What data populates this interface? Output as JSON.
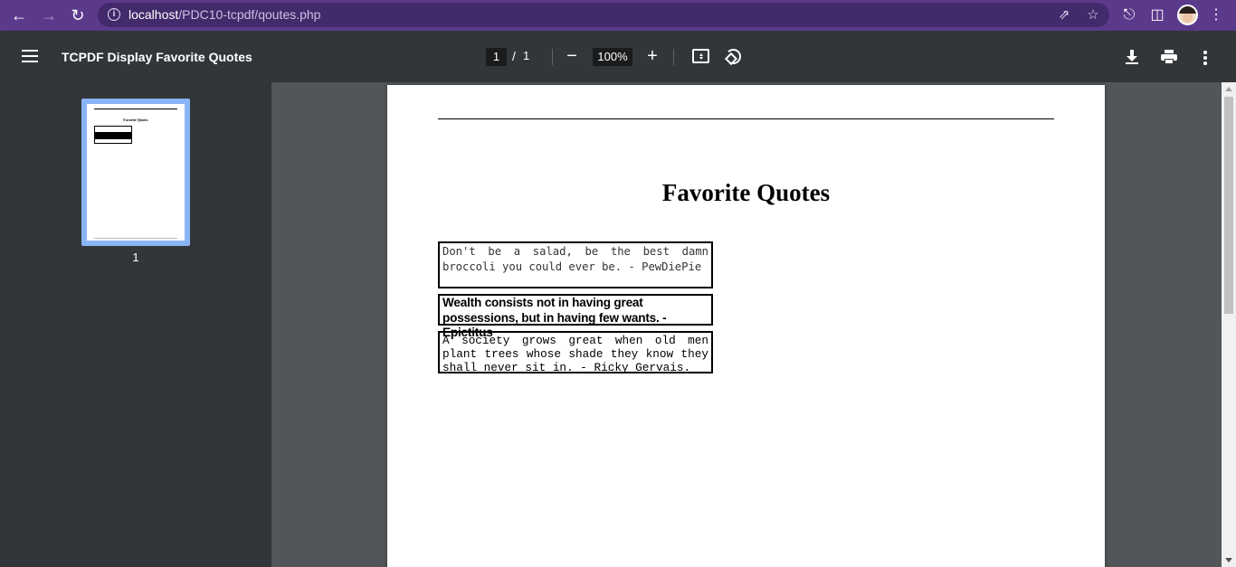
{
  "browser": {
    "url_host": "localhost",
    "url_path": "/PDC10-tcpdf/qoutes.php",
    "icons": [
      "back-icon",
      "forward-icon",
      "reload-icon",
      "info-icon",
      "share-icon",
      "bookmark-star-icon",
      "extensions-icon",
      "side-panel-icon",
      "profile-avatar",
      "chrome-menu-icon"
    ],
    "theme_color": "#5b3a8c"
  },
  "pdf_toolbar": {
    "title": "TCPDF Display Favorite Quotes",
    "current_page": "1",
    "page_separator": "/",
    "total_pages": "1",
    "zoom": "100%"
  },
  "sidebar": {
    "thumbnail_label": "1",
    "thumbnail_title": "Favorite Quotes"
  },
  "document": {
    "title": "Favorite Quotes",
    "quotes": [
      "Don't be a salad, be the best damn broccoli you could ever be. - PewDiePie",
      "Wealth consists not in having great possessions, but in having few wants. - Epictitus",
      "A society grows great when old men plant trees whose shade they know they shall never sit in. - Ricky Gervais."
    ]
  }
}
